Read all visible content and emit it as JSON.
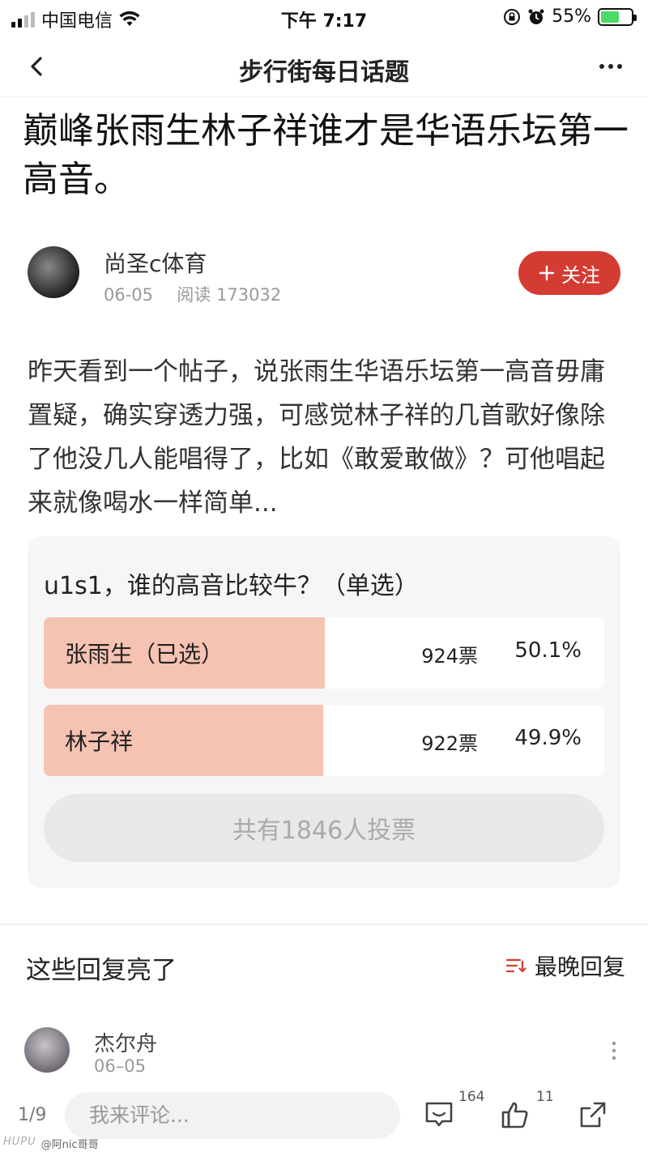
{
  "status_bar": {
    "carrier": "中国电信",
    "time": "下午 7:17",
    "battery_pct": "55%"
  },
  "nav": {
    "title": "步行街每日话题"
  },
  "post": {
    "title": "巅峰张雨生林子祥谁才是华语乐坛第一高音。",
    "author": "尚圣c体育",
    "date": "06-05",
    "read_label": "阅读 173032",
    "follow_label": "关注",
    "body": "昨天看到一个帖子，说张雨生华语乐坛第一高音毋庸置疑，确实穿透力强，可感觉林子祥的几首歌好像除了他没几人能唱得了，比如《敢爱敢做》？可他唱起来就像喝水一样简单..."
  },
  "poll": {
    "question": "u1s1，谁的高音比较牛？（单选）",
    "options": [
      {
        "label": "张雨生（已选）",
        "votes": "924票",
        "pct": "50.1%",
        "fraction": 0.501
      },
      {
        "label": "林子祥",
        "votes": "922票",
        "pct": "49.9%",
        "fraction": 0.499
      }
    ],
    "total_label": "共有1846人投票"
  },
  "replies": {
    "heading": "这些回复亮了",
    "sort_label": "最晚回复",
    "items": [
      {
        "name": "杰尔舟",
        "date": "06–05"
      }
    ]
  },
  "bottom_bar": {
    "page_indicator": "1/9",
    "comment_placeholder": "我来评论...",
    "comment_count": "164",
    "like_count": "11"
  },
  "watermark": {
    "logo": "HUPU",
    "handle": "@阿nic哥哥"
  },
  "colors": {
    "accent": "#d43c33",
    "poll_bar": "#f6c2b2"
  }
}
